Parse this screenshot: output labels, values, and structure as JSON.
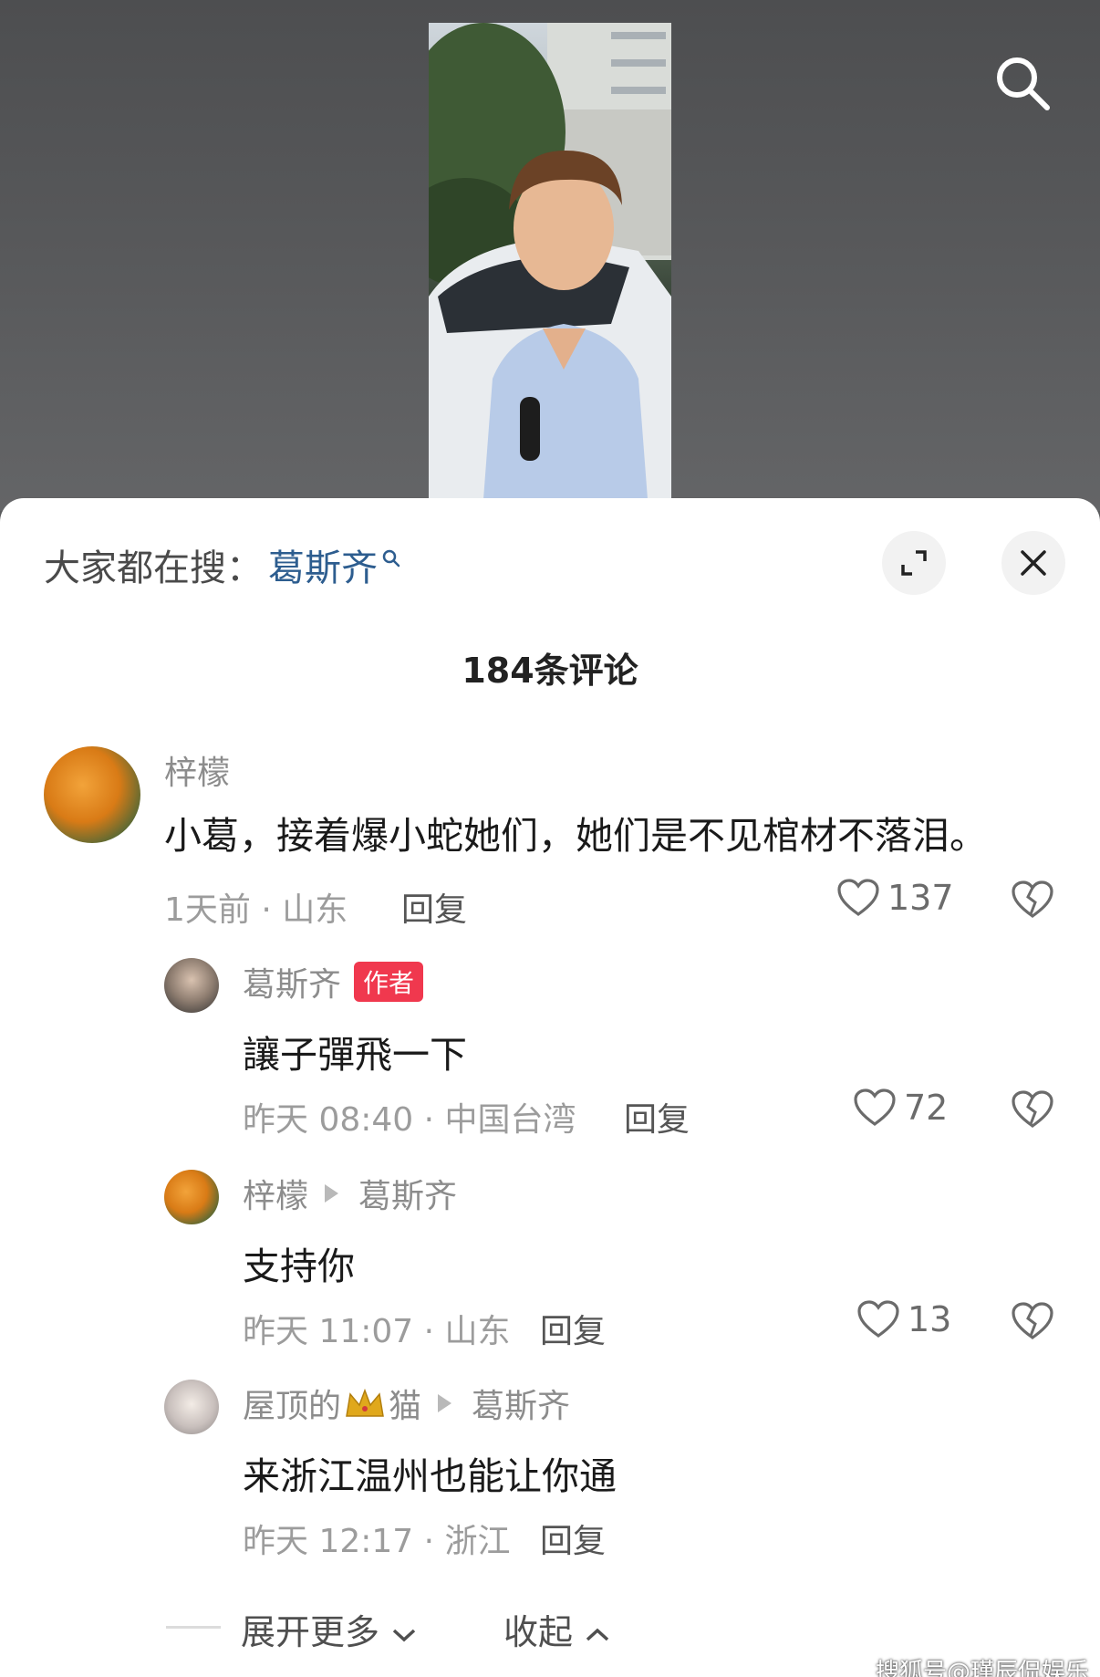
{
  "trending": {
    "prefix": "大家都在搜：",
    "keyword": "葛斯齐"
  },
  "comment_count": "184条评论",
  "comments": [
    {
      "user": "梓檬",
      "text": "小葛，接着爆小蛇她们，她们是不见棺材不落泪。",
      "meta": "1天前 · 山东",
      "reply": "回复",
      "likes": "137"
    },
    {
      "user": "葛斯齐",
      "badge": "作者",
      "text": "讓子彈飛一下",
      "meta": "昨天 08:40 · 中国台湾",
      "reply": "回复",
      "likes": "72"
    },
    {
      "user": "梓檬",
      "reply_to": "葛斯齐",
      "text": "支持你",
      "meta": "昨天 11:07 · 山东",
      "reply": "回复",
      "likes": "13"
    },
    {
      "user_prefix": "屋顶的",
      "user_suffix": "猫",
      "reply_to": "葛斯齐",
      "text": "来浙江温州也能让你通",
      "meta": "昨天 12:17 · 浙江",
      "reply": "回复"
    }
  ],
  "footer": {
    "expand": "展开更多",
    "collapse": "收起"
  },
  "watermark": "搜狐号@瑾辰侃娱乐",
  "icons": {
    "top_search": "search-icon",
    "expand": "expand-icon",
    "close": "close-icon",
    "like": "heart-icon",
    "dislike": "broken-heart-icon",
    "crown": "crown-icon"
  },
  "colors": {
    "keyword": "#2d5d8f",
    "author_badge": "#f0384e"
  }
}
